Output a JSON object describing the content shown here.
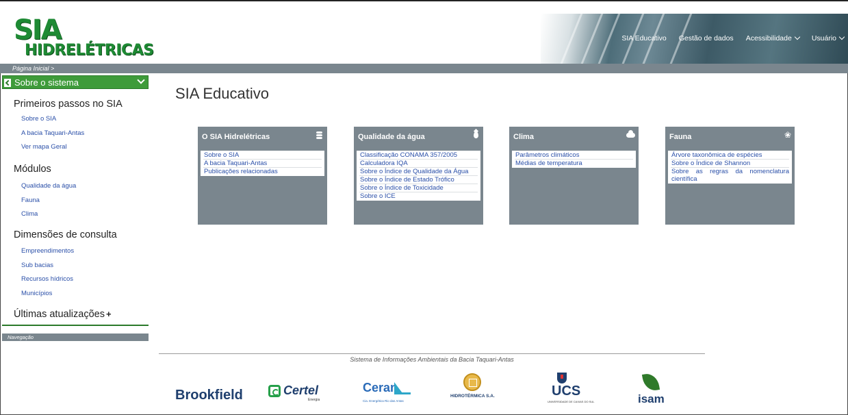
{
  "header": {
    "logo_top": "SIA",
    "logo_bottom": "HIDRELÉTRICAS",
    "nav": [
      "SIA Educativo",
      "Gestão de dados",
      "Acessibilidade",
      "Usuário"
    ]
  },
  "breadcrumb": "Página Inicial >",
  "sidebar": {
    "system_button": "Sobre o sistema",
    "sections": [
      {
        "title": "Primeiros passos no SIA",
        "links": [
          "Sobre o SIA",
          "A bacia Taquari-Antas",
          "Ver mapa Geral"
        ]
      },
      {
        "title": "Módulos",
        "links": [
          "Qualidade da água",
          "Fauna",
          "Clima"
        ]
      },
      {
        "title": "Dimensões de consulta",
        "links": [
          "Empreendimentos",
          "Sub bacias",
          "Recursos hídricos",
          "Municípios"
        ]
      },
      {
        "title": "Últimas atualizações",
        "links": []
      }
    ],
    "plus": "+",
    "nav_label": "Navegação"
  },
  "main": {
    "title": "SIA Educativo",
    "cards": [
      {
        "title": "O SIA Hidrelétricas",
        "icon": "database-icon",
        "links": [
          "Sobre o SIA",
          "A bacia Taquari-Antas",
          "Publicações relacionadas"
        ]
      },
      {
        "title": "Qualidade da água",
        "icon": "water-drop-icon",
        "links": [
          "Classificação CONAMA 357/2005",
          "Calculadora IQA",
          "Sobre o Índice de Qualidade da Água",
          "Sobre o Índice de Estado Trófico",
          "Sobre o Índice de Toxicidade",
          "Sobre o ICE"
        ]
      },
      {
        "title": "Clima",
        "icon": "cloud-icon",
        "links": [
          "Parâmetros climáticos",
          "Médias de temperatura"
        ]
      },
      {
        "title": "Fauna",
        "icon": "paw-icon",
        "links": [
          "Árvore taxonômica de espécies",
          "Sobre o Índice de Shannon",
          "Sobre as regras da nomenclatura científica"
        ]
      }
    ]
  },
  "footer": {
    "text": "Sistema de Informações Ambientais da Bacia Taquari-Antas",
    "partners": {
      "brookfield": "Brookfield",
      "certel": "Certel",
      "certel_sub": "Energia",
      "ceran": "Ceran",
      "ceran_sub": "Cia. Energética Rio das Antas",
      "hidrotermica": "HIDROTÉRMICA S.A.",
      "ucs": "UCS",
      "ucs_sub": "UNIVERSIDADE DE CAXIAS DO SUL",
      "isam": "isam"
    }
  },
  "colors": {
    "brand_green": "#1e8a34",
    "bar_gray": "#7a868e",
    "link_blue": "#2a4fa8"
  }
}
